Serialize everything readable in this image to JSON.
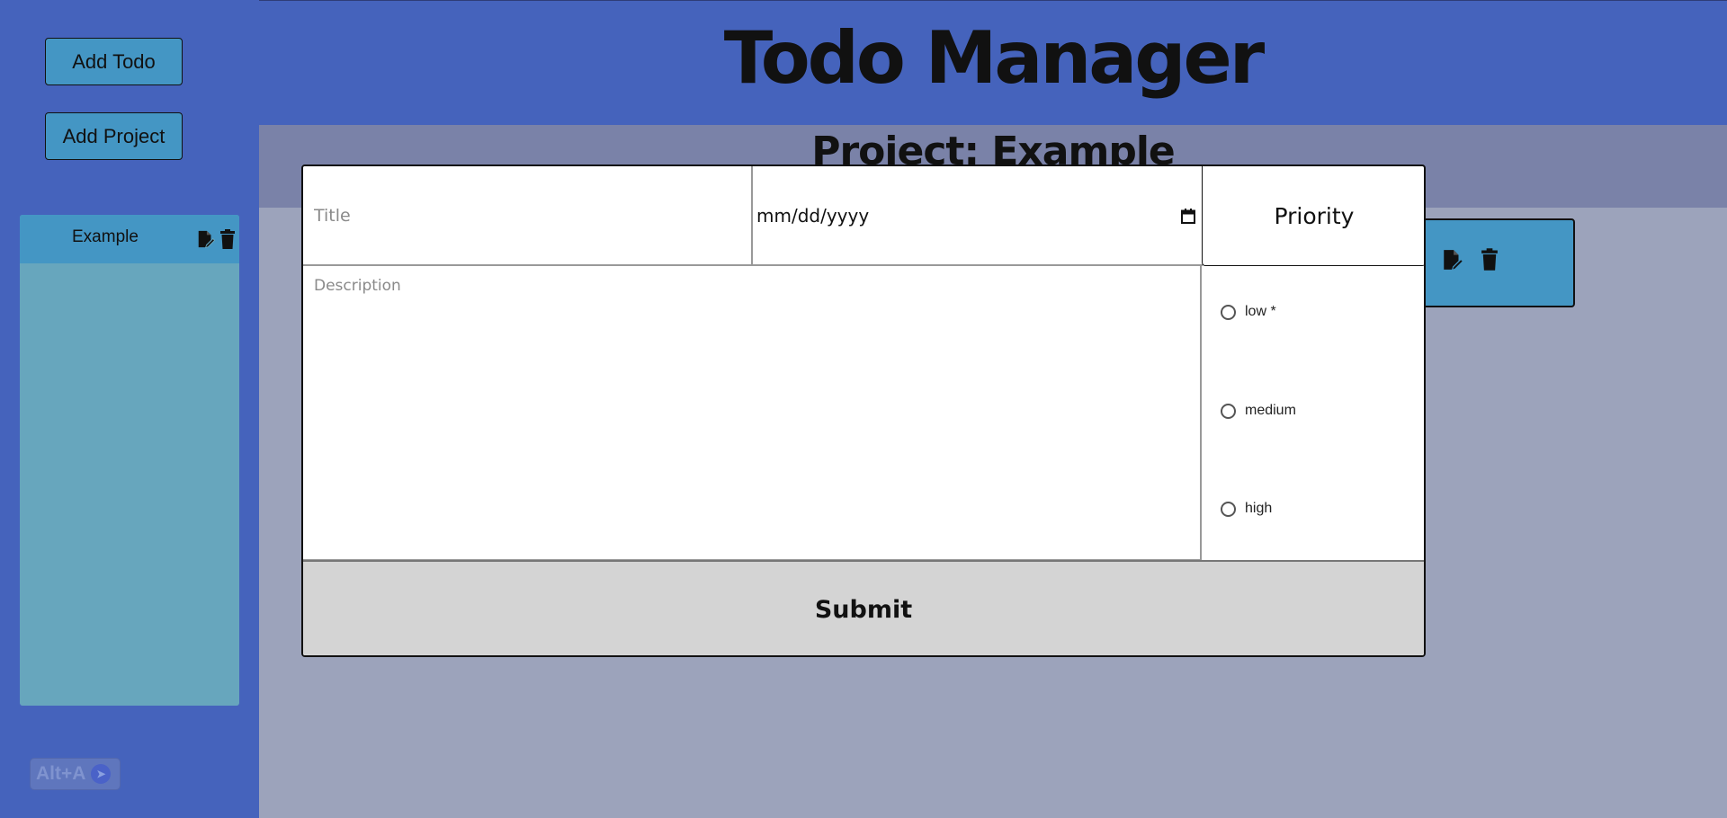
{
  "sidebar": {
    "add_todo_label": "Add Todo",
    "add_project_label": "Add Project",
    "projects": [
      {
        "name": "Example"
      }
    ],
    "shortcut_badge": "Alt+A"
  },
  "header": {
    "title": "Todo Manager"
  },
  "main": {
    "project_title": "Project: Example"
  },
  "form": {
    "title_placeholder": "Title",
    "date_placeholder": "mm/dd/yyyy",
    "priority_heading": "Priority",
    "description_placeholder": "Description",
    "priority_options": [
      {
        "label": "low *",
        "selected": false
      },
      {
        "label": "medium",
        "selected": false
      },
      {
        "label": "high",
        "selected": false
      }
    ],
    "submit_label": "Submit"
  },
  "colors": {
    "background": "#4563bc",
    "main_area": "#9ca3bb",
    "project_header": "#7a82a8",
    "button": "#4496c4",
    "project_panel": "#67a6bd",
    "submit": "#d4d4d4"
  },
  "icons": {
    "edit": "edit-icon",
    "delete": "trash-icon",
    "calendar": "calendar-icon"
  }
}
